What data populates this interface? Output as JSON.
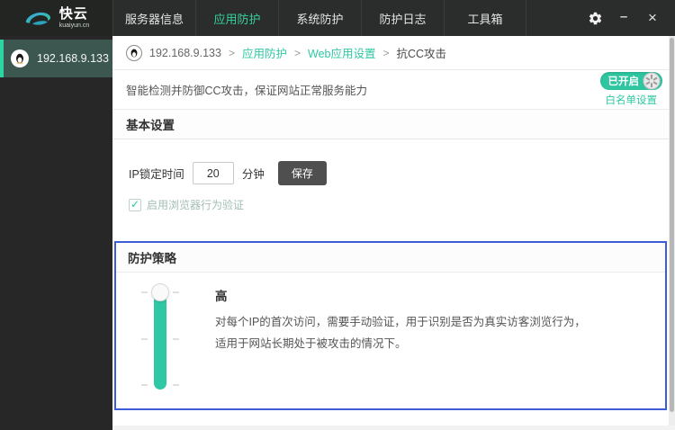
{
  "window": {
    "brand": "快云",
    "brand_sub": "kuaiyun.cn",
    "minimize_glyph": "–",
    "close_glyph": "×"
  },
  "nav": {
    "items": [
      {
        "label": "服务器信息"
      },
      {
        "label": "应用防护"
      },
      {
        "label": "系统防护"
      },
      {
        "label": "防护日志"
      },
      {
        "label": "工具箱"
      }
    ]
  },
  "sidebar": {
    "server_label": "192.168.9.133"
  },
  "breadcrumb": {
    "sep": ">",
    "items": [
      {
        "label": "192.168.9.133"
      },
      {
        "label": "应用防护"
      },
      {
        "label": "Web应用设置"
      },
      {
        "label": "抗CC攻击"
      }
    ]
  },
  "overview": {
    "description": "智能检测并防御CC攻击，保证网站正常服务能力",
    "toggle_label": "已开启",
    "whitelist_link": "白名单设置"
  },
  "basic": {
    "title": "基本设置",
    "ip_lock_label": "IP锁定时间",
    "ip_lock_value": "20",
    "unit": "分钟",
    "save_label": "保存",
    "checkbox_label": "启用浏览器行为验证"
  },
  "policy": {
    "title": "防护策略",
    "level": "高",
    "desc_line1": "对每个IP的首次访问，需要手动验证，用于识别是否为真实访客浏览行为，",
    "desc_line2": "适用于网站长期处于被攻击的情况下。"
  },
  "colors": {
    "accent_green": "#2ec5a0",
    "nav_active_green": "#35d29c",
    "link_green": "#2fc8a2",
    "policy_border_blue": "#3d5cd7",
    "topbar_bg": "#2b2d2c",
    "sidebar_bg": "#272727",
    "sidebar_selected_bg": "#3b574f"
  }
}
